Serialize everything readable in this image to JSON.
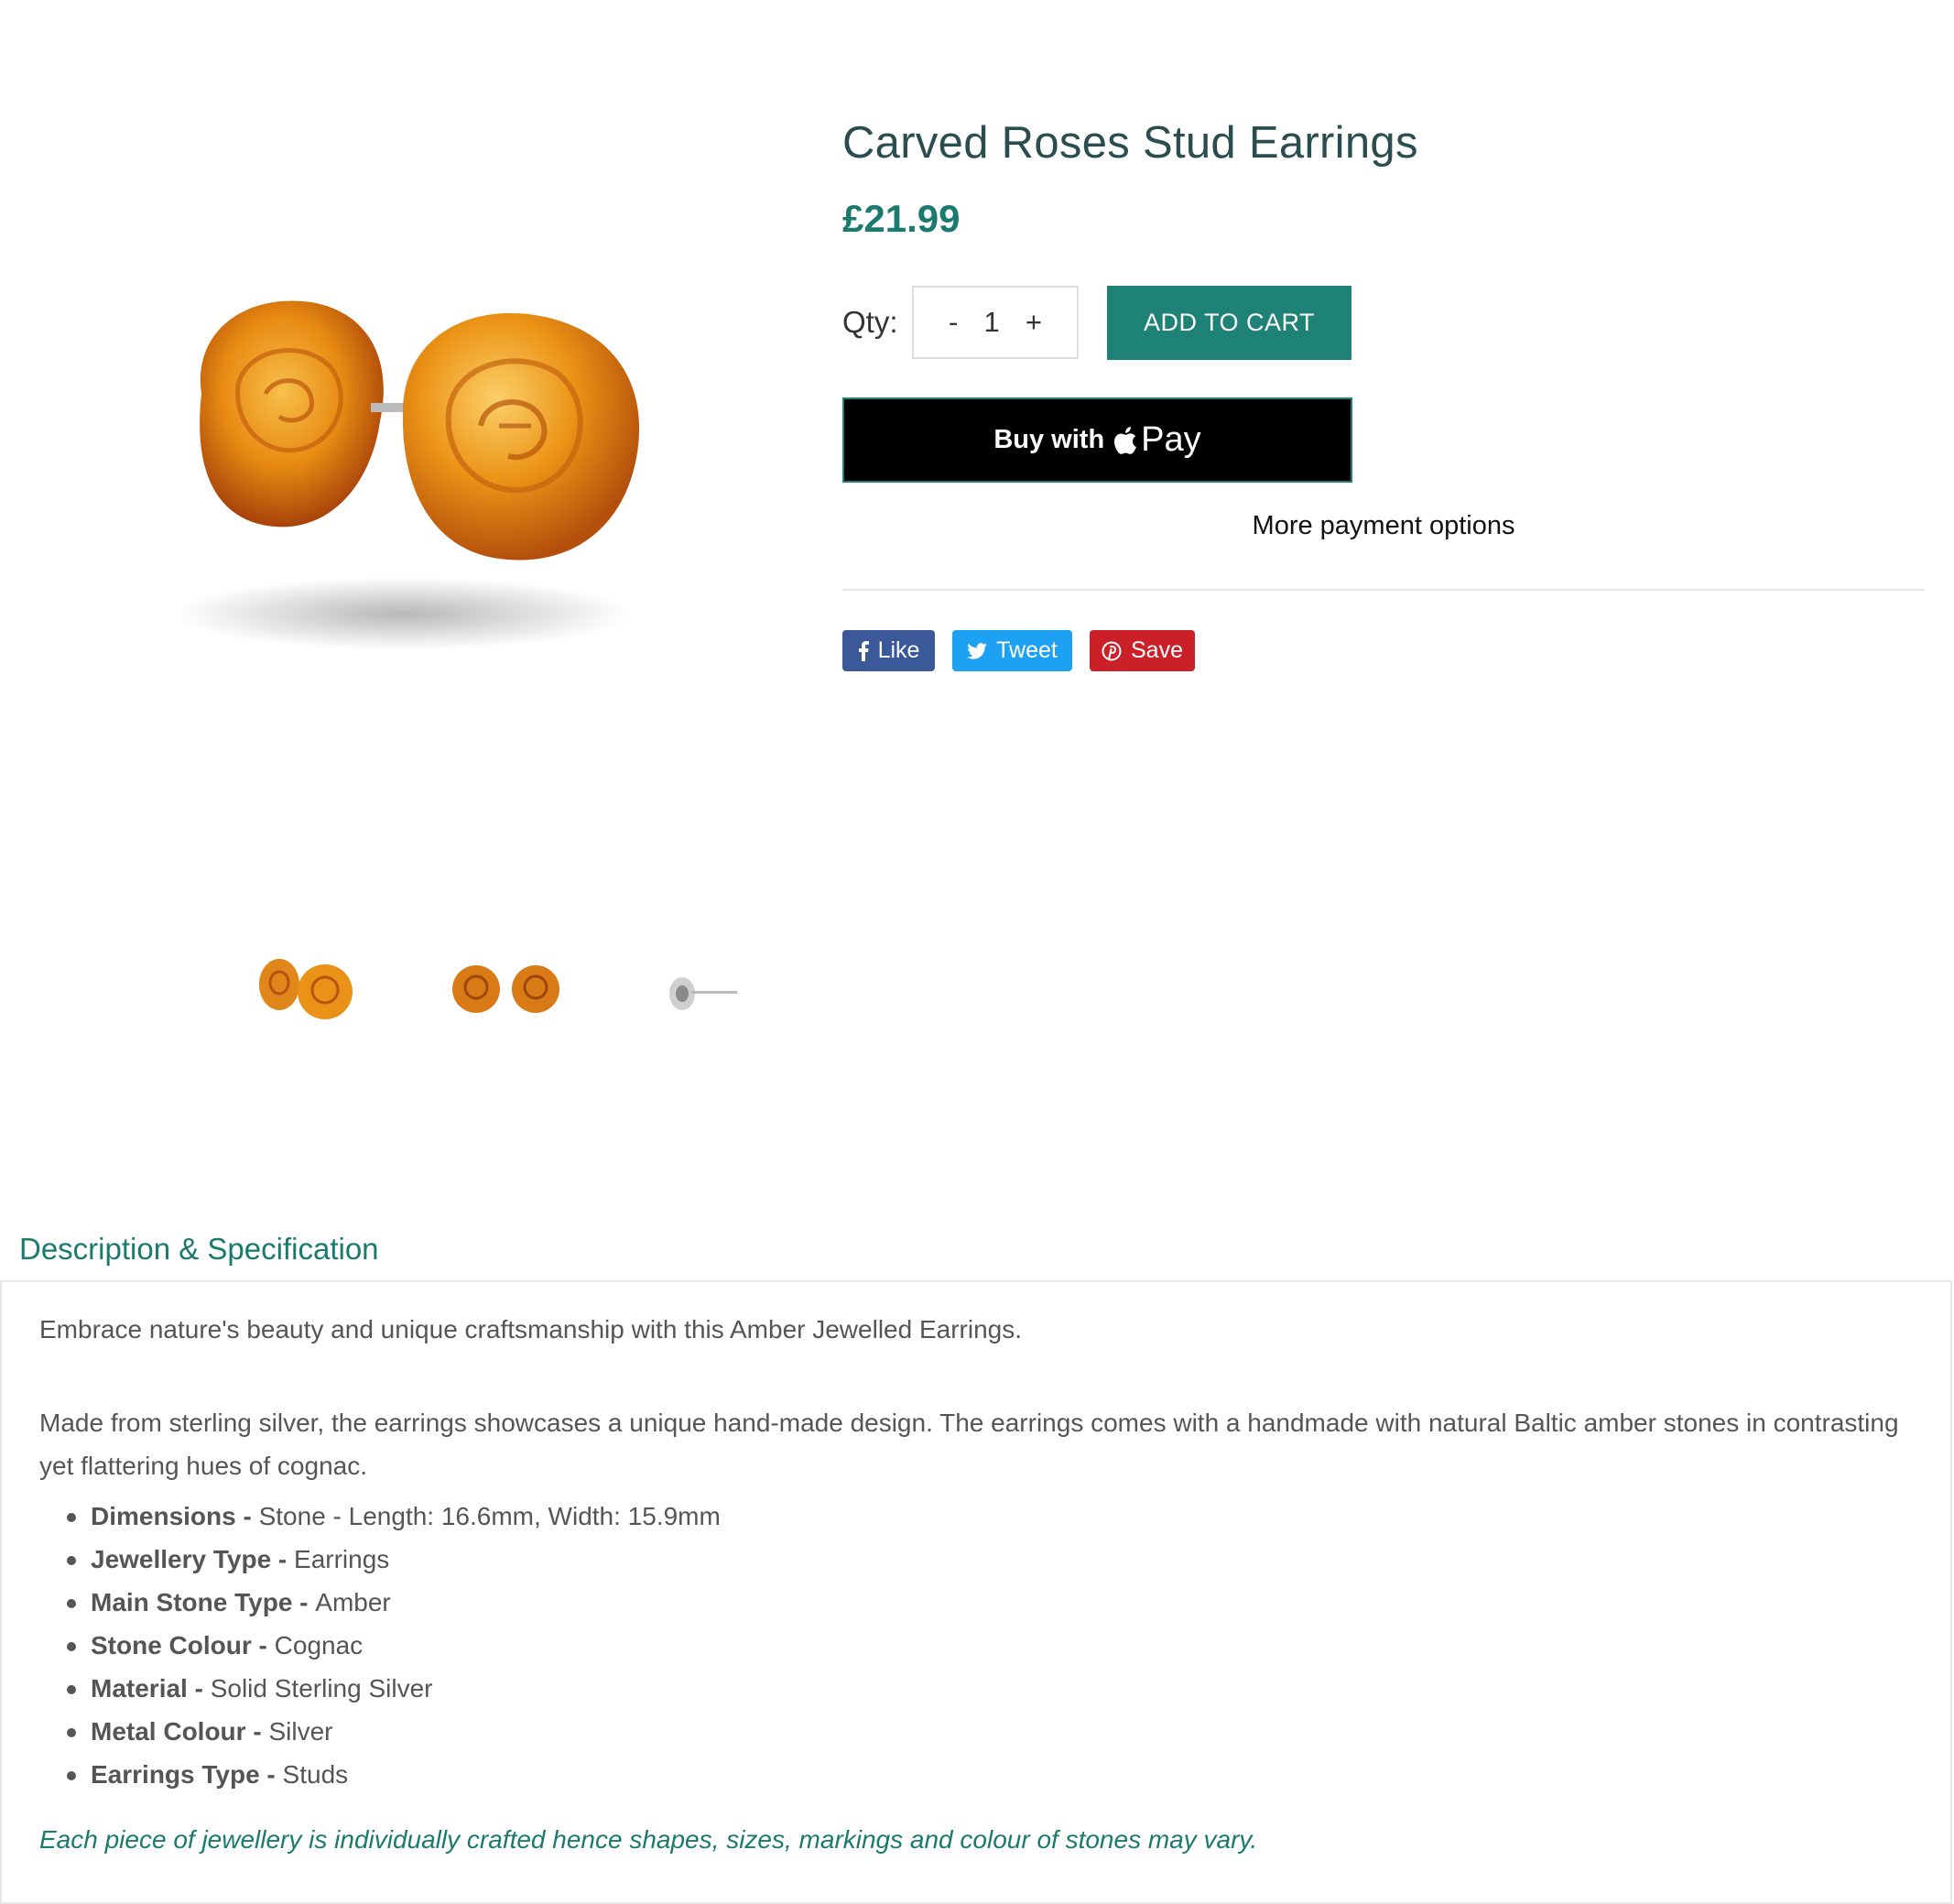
{
  "product": {
    "title": "Carved Roses Stud Earrings",
    "price": "£21.99"
  },
  "purchase": {
    "qty_label": "Qty:",
    "minus": "-",
    "quantity": "1",
    "plus": "+",
    "add_to_cart": "ADD TO CART",
    "buy_with": "Buy with",
    "pay": "Pay",
    "more_options": "More payment options"
  },
  "social": {
    "like": "Like",
    "tweet": "Tweet",
    "save": "Save"
  },
  "description": {
    "heading": "Description & Specification",
    "intro": "Embrace nature's beauty and unique craftsmanship with this Amber Jewelled Earrings.",
    "body": "Made from sterling silver, the earrings showcases a unique hand-made design. The earrings comes with a handmade with natural Baltic amber stones in contrasting yet flattering hues of cognac.",
    "specs": [
      {
        "label": "Dimensions - ",
        "value": "Stone - Length: 16.6mm, Width: 15.9mm"
      },
      {
        "label": "Jewellery Type - ",
        "value": "Earrings"
      },
      {
        "label": "Main Stone Type - ",
        "value": "Amber"
      },
      {
        "label": "Stone Colour - ",
        "value": "Cognac"
      },
      {
        "label": "Material - ",
        "value": "Solid Sterling Silver"
      },
      {
        "label": "Metal Colour - ",
        "value": "Silver"
      },
      {
        "label": "Earrings Type - ",
        "value": "Studs"
      }
    ],
    "note": "Each piece of jewellery is individually crafted hence shapes, sizes, markings and colour of stones may vary."
  },
  "colors": {
    "accent": "#1f8277",
    "title": "#2b4d4f",
    "facebook": "#3b5998",
    "twitter": "#1da1f2",
    "pinterest": "#cb2027"
  },
  "icons": [
    "apple-icon",
    "facebook-icon",
    "twitter-icon",
    "pinterest-icon"
  ]
}
